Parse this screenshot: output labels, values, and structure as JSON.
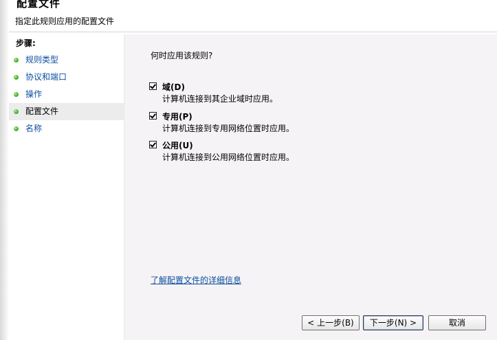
{
  "header": {
    "title": "配置文件",
    "subtitle": "指定此规则应用的配置文件"
  },
  "steps": {
    "heading": "步骤:",
    "items": [
      {
        "label": "规则类型",
        "active": false
      },
      {
        "label": "协议和端口",
        "active": false
      },
      {
        "label": "操作",
        "active": false
      },
      {
        "label": "配置文件",
        "active": true
      },
      {
        "label": "名称",
        "active": false
      }
    ]
  },
  "content": {
    "question": "何时应用该规则?",
    "options": [
      {
        "label": "域(D)",
        "description": "计算机连接到其企业域时应用。",
        "checked": true
      },
      {
        "label": "专用(P)",
        "description": "计算机连接到专用网络位置时应用。",
        "checked": true
      },
      {
        "label": "公用(U)",
        "description": "计算机连接到公用网络位置时应用。",
        "checked": true
      }
    ],
    "learn_more": "了解配置文件的详细信息"
  },
  "buttons": {
    "back": "< 上一步(B)",
    "next": "下一步(N) >",
    "cancel": "取消"
  }
}
